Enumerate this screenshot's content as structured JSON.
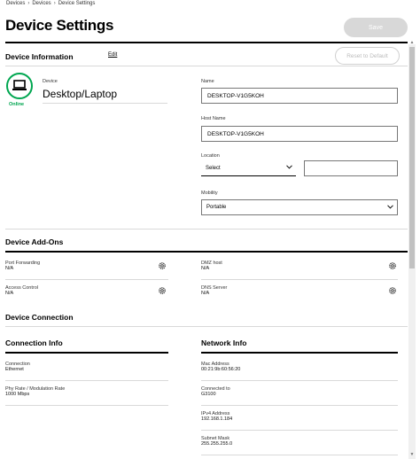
{
  "breadcrumb": [
    "Devices",
    "Devices",
    "Device Settings"
  ],
  "page_title": "Device Settings",
  "save_label": "Save",
  "device_info": {
    "title": "Device Information",
    "edit_label": "Edit",
    "reset_label": "Reset to Default",
    "status": "Online",
    "device_label": "Device",
    "device_type": "Desktop/Laptop",
    "name_label": "Name",
    "name_value": "DESKTOP-V1G5KOH",
    "host_label": "Host Name",
    "host_value": "DESKTOP-V1G5KOH",
    "location_label": "Location",
    "location_selected": "Select",
    "location_text": "",
    "mobility_label": "Mobility",
    "mobility_selected": "Portable"
  },
  "addons": {
    "title": "Device Add-Ons",
    "items": [
      {
        "label": "Port Forwarding",
        "value": "N/A"
      },
      {
        "label": "DMZ host",
        "value": "N/A"
      },
      {
        "label": "Access Control",
        "value": "N/A"
      },
      {
        "label": "DNS Server",
        "value": "N/A"
      }
    ]
  },
  "connection": {
    "title": "Device Connection",
    "info_title": "Connection Info",
    "network_title": "Network Info",
    "left": [
      {
        "label": "Connection",
        "value": "Ethernet"
      },
      {
        "label": "Phy Rate / Modulation Rate",
        "value": "1000 Mbps"
      }
    ],
    "right": [
      {
        "label": "Mac Address",
        "value": "00:21:9b:60:56:20"
      },
      {
        "label": "Connected to",
        "value": "G3100"
      },
      {
        "label": "IPv4 Address",
        "value": "192.168.1.184"
      },
      {
        "label": "Subnet Mask",
        "value": "255.255.255.0"
      }
    ]
  },
  "icons": {
    "device": "laptop-icon",
    "gear": "gear-icon",
    "chevron": "chevron-down-icon"
  },
  "colors": {
    "online": "#00a650",
    "save_disabled": "#d8d8d8"
  }
}
